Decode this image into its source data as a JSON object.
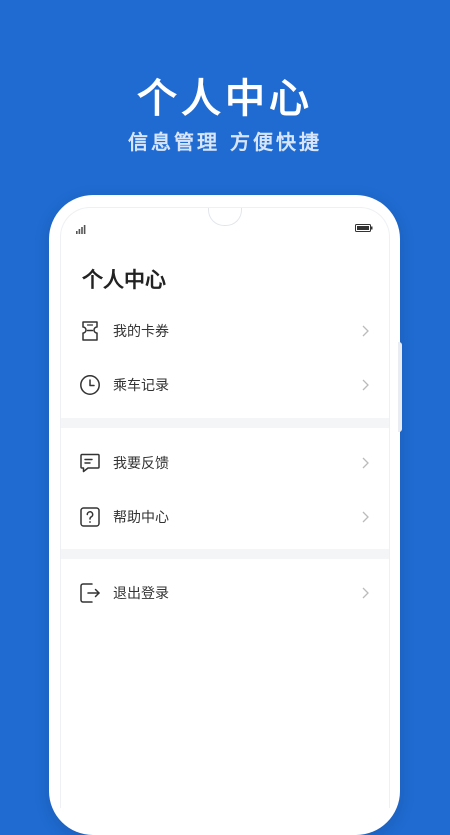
{
  "hero": {
    "title": "个人中心",
    "subtitle": "信息管理  方便快捷"
  },
  "screen": {
    "page_title": "个人中心",
    "groups": [
      {
        "items": [
          {
            "label": "我的卡券",
            "icon": "ticket-icon"
          },
          {
            "label": "乘车记录",
            "icon": "clock-icon"
          }
        ]
      },
      {
        "items": [
          {
            "label": "我要反馈",
            "icon": "feedback-icon"
          },
          {
            "label": "帮助中心",
            "icon": "help-icon"
          }
        ]
      },
      {
        "items": [
          {
            "label": "退出登录",
            "icon": "logout-icon"
          }
        ]
      }
    ]
  },
  "colors": {
    "background": "#1f6bd1",
    "icon_stroke": "#333333",
    "chevron": "#bbbbbb"
  }
}
